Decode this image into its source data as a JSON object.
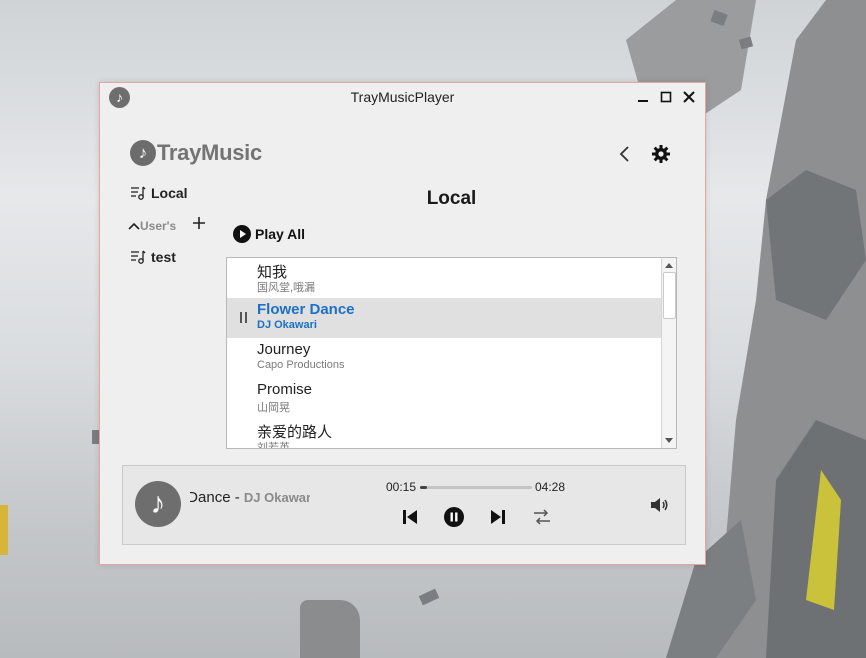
{
  "window": {
    "title": "TrayMusicPlayer",
    "app_icon": "music-note-icon"
  },
  "logo": {
    "text": "TrayMusic"
  },
  "sidebar": {
    "local_label": "Local",
    "users_label": "User's",
    "playlists": [
      {
        "label": "test"
      }
    ]
  },
  "main": {
    "page_title": "Local",
    "play_all_label": "Play All"
  },
  "songs": [
    {
      "title": "知我",
      "artist": "国风堂,哦漏"
    },
    {
      "title": "Flower Dance",
      "artist": "DJ Okawari",
      "active": true
    },
    {
      "title": "Journey",
      "artist": "Capo Productions"
    },
    {
      "title": "Promise",
      "artist": "山岡晃"
    },
    {
      "title": "亲爱的路人",
      "artist": "刘若英"
    }
  ],
  "player": {
    "now_playing_title": "Flower Dance",
    "separator": " - ",
    "now_playing_artist": "DJ Okawari",
    "current_time": "00:15",
    "total_time": "04:28",
    "progress": 0.06
  },
  "colors": {
    "accent": "#1c70c9",
    "window_border": "#e6a3a3"
  }
}
